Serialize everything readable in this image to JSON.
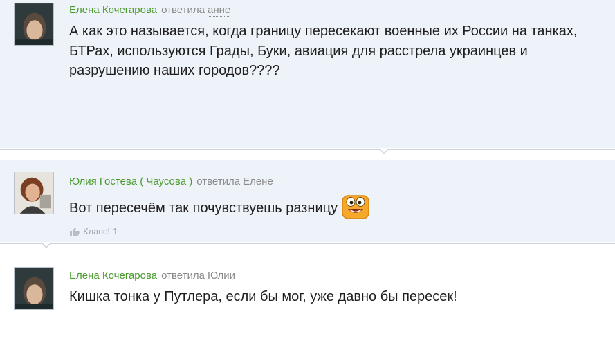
{
  "comments": [
    {
      "author": "Елена Кочегарова",
      "action": "ответила",
      "target": "анне",
      "text": "А как это называется, когда границу пересекают военные их России на танках, БТРах, используются  Грады, Буки, авиация для расстрела украинцев и разрушению наших городов????"
    },
    {
      "author": "Юлия Гостева ( Чаусова )",
      "action": "ответила",
      "target": "Елене",
      "text": "Вот пересечём так почувствуешь разницу",
      "like_label": "Класс!",
      "like_count": "1"
    },
    {
      "author": "Елена Кочегарова",
      "action": "ответила",
      "target": "Юлии",
      "text": "Кишка тонка у Путлера, если бы мог, уже давно бы пересек!"
    }
  ],
  "colors": {
    "author": "#4a9a2c",
    "meta": "#8a8a8a",
    "bubble_bg": "#eef3f9",
    "separator": "#c9d3dd"
  },
  "icons": {
    "smiley": "laughing-smiley-icon",
    "like": "thumbs-up-icon"
  }
}
